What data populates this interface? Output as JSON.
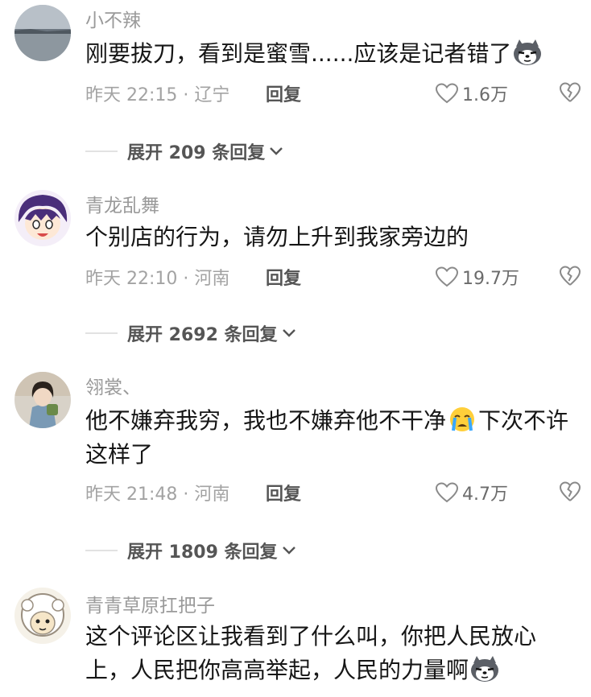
{
  "comments": [
    {
      "username": "小不辣",
      "text_parts": [
        "刚要拔刀，看到是蜜雪......应该是记者错了"
      ],
      "emoji_end": "husky-emoji",
      "time": "昨天 22:15 · 辽宁",
      "reply_label": "回复",
      "likes": "1.6万",
      "expand_label": "展开 209 条回复"
    },
    {
      "username": "青龙乱舞",
      "text_parts": [
        "个别店的行为，请勿上升到我家旁边的"
      ],
      "time": "昨天 22:10 · 河南",
      "reply_label": "回复",
      "likes": "19.7万",
      "expand_label": "展开 2692 条回复"
    },
    {
      "username": "翎裳、",
      "text_parts": [
        "他不嫌弃我穷，我也不嫌弃他不干净",
        "下次不许这样了"
      ],
      "emoji_mid": "crying-emoji",
      "time": "昨天 21:48 · 河南",
      "reply_label": "回复",
      "likes": "4.7万",
      "expand_label": "展开 1809 条回复"
    },
    {
      "username": "青青草原扛把子",
      "text_parts": [
        "这个评论区让我看到了什么叫，你把人民放心上，人民把你高高举起，人民的力量啊"
      ],
      "emoji_end": "husky-emoji"
    }
  ],
  "colors": {
    "username": "#9a9a9a",
    "meta": "#a3a3a3",
    "text": "#161616",
    "reply": "#555555"
  }
}
